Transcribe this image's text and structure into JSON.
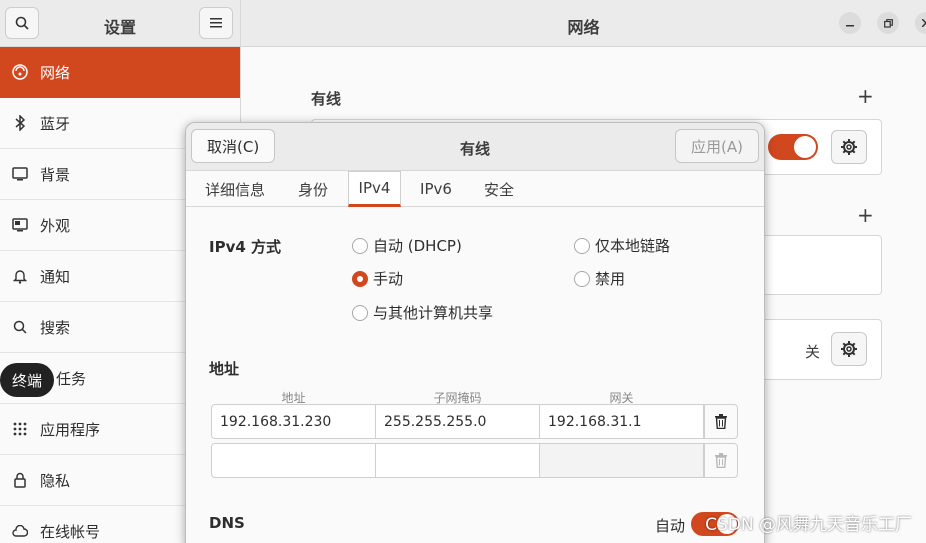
{
  "sidebar": {
    "title": "设置",
    "items": [
      {
        "label": "网络",
        "icon": "network-icon"
      },
      {
        "label": "蓝牙",
        "icon": "bluetooth-icon"
      },
      {
        "label": "背景",
        "icon": "background-icon"
      },
      {
        "label": "外观",
        "icon": "appearance-icon"
      },
      {
        "label": "通知",
        "icon": "bell-icon"
      },
      {
        "label": "搜索",
        "icon": "search-icon"
      },
      {
        "label": "任务",
        "icon": "tasks-icon"
      },
      {
        "label": "应用程序",
        "icon": "apps-grid-icon"
      },
      {
        "label": "隐私",
        "icon": "lock-icon"
      },
      {
        "label": "在线帐号",
        "icon": "cloud-icon"
      }
    ],
    "tooltip": "终端"
  },
  "main": {
    "title": "网络",
    "wired_label": "有线",
    "off_label": "关",
    "accent": "#d1471e"
  },
  "dialog": {
    "title": "有线",
    "cancel": "取消(C)",
    "apply": "应用(A)",
    "tabs": [
      "详细信息",
      "身份",
      "IPv4",
      "IPv6",
      "安全"
    ],
    "active_tab": "IPv4",
    "method_label": "IPv4 方式",
    "methods": {
      "auto": "自动 (DHCP)",
      "link_local": "仅本地链路",
      "manual": "手动",
      "disabled": "禁用",
      "shared": "与其他计算机共享"
    },
    "selected_method": "手动",
    "address_label": "地址",
    "columns": [
      "地址",
      "子网掩码",
      "网关"
    ],
    "rows": [
      [
        "192.168.31.230",
        "255.255.255.0",
        "192.168.31.1"
      ],
      [
        "",
        "",
        ""
      ]
    ],
    "dns_label": "DNS",
    "dns_auto_label": "自动"
  },
  "watermark": "CSDN @风舞九天音乐工厂"
}
